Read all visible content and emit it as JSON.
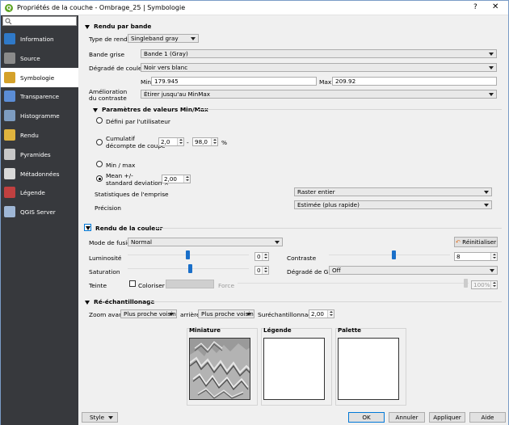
{
  "window": {
    "title": "Propriétés de la couche - Ombrage_25 | Symbologie",
    "help": "?",
    "close": "✕"
  },
  "sidebar": {
    "search_placeholder": "",
    "items": [
      {
        "label": "Information",
        "icon": "info-icon",
        "color": "#2f79c8"
      },
      {
        "label": "Source",
        "icon": "source-icon",
        "color": "#8a8a8a"
      },
      {
        "label": "Symbologie",
        "icon": "symbology-brush-icon",
        "color": "#d4a12a"
      },
      {
        "label": "Transparence",
        "icon": "transparency-icon",
        "color": "#5b8dd6"
      },
      {
        "label": "Histogramme",
        "icon": "histogram-icon",
        "color": "#7d9cc0"
      },
      {
        "label": "Rendu",
        "icon": "rendering-brush-icon",
        "color": "#e0b43e"
      },
      {
        "label": "Pyramides",
        "icon": "pyramids-icon",
        "color": "#c8c8c8"
      },
      {
        "label": "Métadonnées",
        "icon": "metadata-icon",
        "color": "#d9d9d9"
      },
      {
        "label": "Légende",
        "icon": "legend-icon",
        "color": "#c04040"
      },
      {
        "label": "QGIS Server",
        "icon": "server-icon",
        "color": "#9fb7d6"
      }
    ]
  },
  "band_render": {
    "header": "Rendu par bande",
    "render_type_label": "Type de rendu",
    "render_type": "Singleband gray",
    "gray_band_label": "Bande grise",
    "gray_band": "Bande 1 (Gray)",
    "gradient_label": "Dégradé de couleur",
    "gradient": "Noir vers blanc",
    "min_label": "Min",
    "min": "179.945",
    "max_label": "Max",
    "max": "209.92",
    "contrast_label_1": "Amélioration",
    "contrast_label_2": "du contraste",
    "contrast": "Étirer jusqu'au MinMax"
  },
  "minmax": {
    "header": "Paramètres de valeurs Min/Max",
    "user_defined": "Défini par l'utilisateur",
    "cumulative_1": "Cumulatif",
    "cumulative_2": "décompte de coupe",
    "cut_low": "2,0",
    "dash": "-",
    "cut_high": "98,0",
    "percent": "%",
    "minmax_opt": "Min / max",
    "mean_1": "Mean +/-",
    "mean_2": "standard deviation ×",
    "stddev": "2,00",
    "extent_label": "Statistiques de l'emprise",
    "extent": "Raster entier",
    "accuracy_label": "Précision",
    "accuracy": "Estimée (plus rapide)"
  },
  "color_render": {
    "header": "Rendu de la couleur",
    "blend_label": "Mode de fusion",
    "blend": "Normal",
    "reset": "Réinitialiser",
    "brightness_label": "Luminosité",
    "brightness": "0",
    "contrast_label": "Contraste",
    "contrast": "8",
    "saturation_label": "Saturation",
    "saturation": "0",
    "grayscale_label": "Dégradé de Gris",
    "grayscale": "Off",
    "hue_label": "Teinte",
    "colorize": "Coloriser",
    "strength_label": "Force",
    "strength": "100%"
  },
  "resampling": {
    "header": "Ré-échantillonage",
    "zoom_in_label": "Zoom avant",
    "zoom_in": "Plus proche voisin",
    "zoom_out_label": "arrière",
    "zoom_out": "Plus proche voisin",
    "oversampling_label": "Suréchantillonnage",
    "oversampling": "2,00"
  },
  "previews": {
    "thumbnail": "Miniature",
    "legend": "Légende",
    "palette": "Palette"
  },
  "footer": {
    "style": "Style",
    "ok": "OK",
    "cancel": "Annuler",
    "apply": "Appliquer",
    "help": "Aide"
  }
}
